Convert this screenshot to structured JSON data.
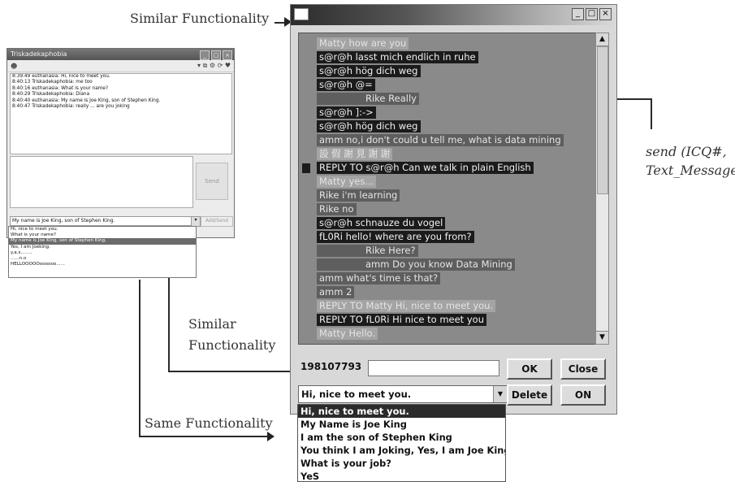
{
  "labels": {
    "similar_top": "Similar Functionality",
    "similar_mid_1": "Similar",
    "similar_mid_2": "Functionality",
    "same": "Same Functionality",
    "send_fn": "send",
    "send_args_1": "(ICQ#,",
    "send_args_2": "Text_Message)"
  },
  "small_window": {
    "title": "Triskadekaphobia",
    "chat_lines": [
      "8:39:49  euthanasia: Hi, nice to meet you.",
      "8:40:13  Triskadekaphobia: me too",
      "8:40:16  euthanasia: What is your name?",
      "8:40:29  Triskadekaphobia: Diana",
      "8:40:40  euthanasia: My name is Joe King, son of Stephen King.",
      "8:40:47  Triskadekaphobia: really ... are you joking"
    ],
    "send_label": "Send",
    "combo_value": "My name is Joe King, son of Stephen King.",
    "add_label": "Add/Send",
    "list_items": [
      "Hi, nice to meet you.",
      "What is your name?",
      "My name is Joe King, son of Stephen King.",
      "Yes, I am Joeking.",
      "y.a.s........",
      "......n.o",
      "HELLOOOOOoooooo......"
    ]
  },
  "big_window": {
    "messages": [
      {
        "text": "Matty how are you",
        "tone": "lt"
      },
      {
        "text": "s@r@h lasst mich endlich in ruhe",
        "tone": "dk"
      },
      {
        "text": "s@r@h hög dich weg",
        "tone": "dk"
      },
      {
        "text": "s@r@h @=",
        "tone": "dk"
      },
      {
        "text": "Rike Really",
        "tone": "md"
      },
      {
        "text": "s@r@h ]:->",
        "tone": "dk"
      },
      {
        "text": "s@r@h hög dich weg",
        "tone": "dk"
      },
      {
        "text": "amm no,i don't could u tell me, what is data mining",
        "tone": "md"
      },
      {
        "text": "設 假 謝 見 謝 謝",
        "tone": "lt"
      },
      {
        "text": "REPLY TO s@r@h Can we talk in plain English",
        "tone": "dk"
      },
      {
        "text": "Matty yes...",
        "tone": "lt"
      },
      {
        "text": "Rike i'm learning",
        "tone": "md"
      },
      {
        "text": "Rike no",
        "tone": "md"
      },
      {
        "text": "s@r@h schnauze du vogel",
        "tone": "dk"
      },
      {
        "text": "fL0Ri hello! where are you from?",
        "tone": "dk"
      },
      {
        "text": "Rike Here?",
        "tone": "md"
      },
      {
        "text": "amm Do you know Data Mining",
        "tone": "md"
      },
      {
        "text": "amm what's time is that?",
        "tone": "md"
      },
      {
        "text": "amm 2",
        "tone": "md"
      },
      {
        "text": "REPLY TO Matty Hi, nice to meet you.",
        "tone": "lt"
      },
      {
        "text": "REPLY TO fL0Ri Hi nice to meet you",
        "tone": "dk"
      },
      {
        "text": "Matty Hello.",
        "tone": "lt"
      }
    ],
    "icq_number": "198107793",
    "ok_label": "OK",
    "close_label": "Close",
    "delete_label": "Delete",
    "on_label": "ON",
    "combo_value": "Hi, nice to meet you.",
    "list_items": [
      "Hi, nice to meet you.",
      "My Name is Joe King",
      "I am the son of Stephen King",
      "You think I am Joking, Yes, I am Joe King",
      "What is your job?",
      "YeS"
    ]
  }
}
